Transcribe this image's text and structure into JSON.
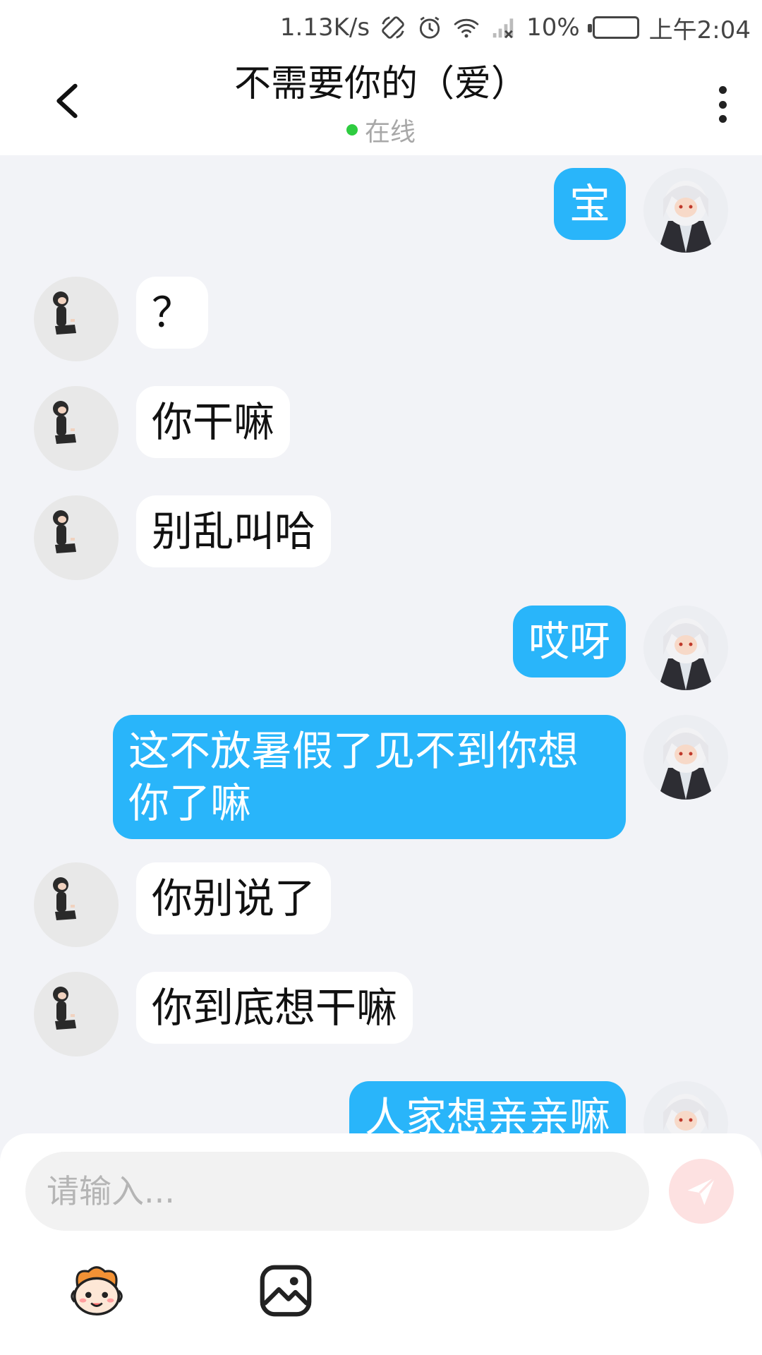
{
  "status_bar": {
    "network_speed": "1.13K/s",
    "battery_percent": "10%",
    "time": "上午2:04",
    "icons": [
      "rotate-icon",
      "alarm-icon",
      "wifi-icon",
      "signal-icon",
      "battery-icon"
    ]
  },
  "header": {
    "title": "不需要你的（爱）",
    "status": "在线"
  },
  "messages": [
    {
      "side": "out",
      "text": "宝"
    },
    {
      "side": "in",
      "text": "？"
    },
    {
      "side": "in",
      "text": "你干嘛"
    },
    {
      "side": "in",
      "text": "别乱叫哈"
    },
    {
      "side": "out",
      "text": "哎呀"
    },
    {
      "side": "out",
      "text": "这不放暑假了见不到你想你了嘛"
    },
    {
      "side": "in",
      "text": "你别说了"
    },
    {
      "side": "in",
      "text": "你到底想干嘛"
    },
    {
      "side": "out",
      "text": "人家想亲亲嘛"
    }
  ],
  "input": {
    "placeholder": "请输入..."
  },
  "colors": {
    "outgoing_bubble": "#29b5fa",
    "incoming_bubble": "#ffffff",
    "background": "#f2f3f7",
    "online_dot": "#2ecc40",
    "battery_fill": "#f5c518"
  }
}
